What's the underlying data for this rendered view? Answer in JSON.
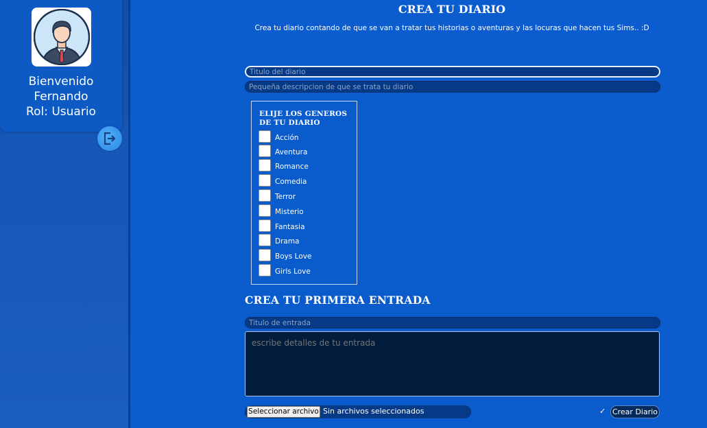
{
  "sidebar": {
    "avatar_icon": "user-avatar-icon",
    "welcome_line1": "Bienvenido",
    "user_name": "Fernando",
    "role_line": "Rol: Usuario",
    "logout_icon": "logout-icon"
  },
  "header": {
    "title": "CREA TU DIARIO",
    "subtitle": "Crea tu diario contando de que se van a tratar tus historias o aventuras y las locuras que hacen tus Sims.. :D"
  },
  "diary_form": {
    "title_placeholder": "Titulo del diario",
    "description_placeholder": "Pequeña descripcion de que se trata tu diario",
    "genres_title": "ELIJE LOS GENEROS DE TU DIARIO",
    "genres": [
      {
        "label": "Acción",
        "checked": false
      },
      {
        "label": "Aventura",
        "checked": false
      },
      {
        "label": "Romance",
        "checked": false
      },
      {
        "label": "Comedia",
        "checked": false
      },
      {
        "label": "Terror",
        "checked": false
      },
      {
        "label": "Misterio",
        "checked": false
      },
      {
        "label": "Fantasia",
        "checked": false
      },
      {
        "label": "Drama",
        "checked": false
      },
      {
        "label": "Boys Love",
        "checked": false
      },
      {
        "label": "Girls Love",
        "checked": false
      }
    ]
  },
  "entry_form": {
    "section_title": "CREA TU PRIMERA ENTRADA",
    "entry_title_placeholder": "Titulo de entrada",
    "entry_details_placeholder": "escribe detalles de tu entrada",
    "file_button_label": "Seleccionar archivo",
    "file_status": "Sin archivos seleccionados",
    "agree_mark": "✓",
    "create_button_label": "Crear Diario"
  },
  "colors": {
    "background": "#0b5ccf",
    "sidebar": "#0e4fa8",
    "input_bg": "#063a86",
    "textarea_bg": "#011c3c"
  }
}
